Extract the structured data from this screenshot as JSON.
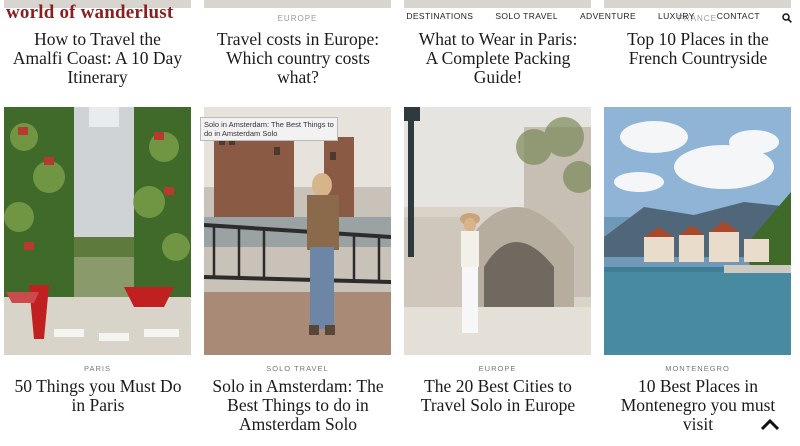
{
  "header": {
    "logo": "world of wanderlust",
    "nav": [
      "DESTINATIONS",
      "SOLO TRAVEL",
      "ADVENTURE",
      "LUXURY",
      "CONTACT"
    ]
  },
  "top_row": [
    {
      "category": "",
      "title": "How to Travel the Amalfi Coast: A 10 Day Itinerary"
    },
    {
      "category": "EUROPE",
      "title": "Travel costs in Europe: Which country costs what?"
    },
    {
      "category": "",
      "title": "What to Wear in Paris: A Complete Packing Guide!"
    },
    {
      "category": "FRANCE",
      "title": "Top 10 Places in the French Countryside"
    }
  ],
  "cards": [
    {
      "category": "PARIS",
      "title": "50 Things you Must Do in Paris"
    },
    {
      "category": "SOLO TRAVEL",
      "title": "Solo in Amsterdam: The Best Things to do in Amsterdam Solo"
    },
    {
      "category": "EUROPE",
      "title": "The 20 Best Cities to Travel Solo in Europe"
    },
    {
      "category": "MONTENEGRO",
      "title": "10 Best Places in Montenegro you must visit"
    }
  ],
  "tooltip": "Solo in Amsterdam: The Best Things to do in Amsterdam Solo",
  "colors": {
    "logo": "#8b1e1e",
    "text": "#1a1a1a",
    "category": "#777777"
  }
}
